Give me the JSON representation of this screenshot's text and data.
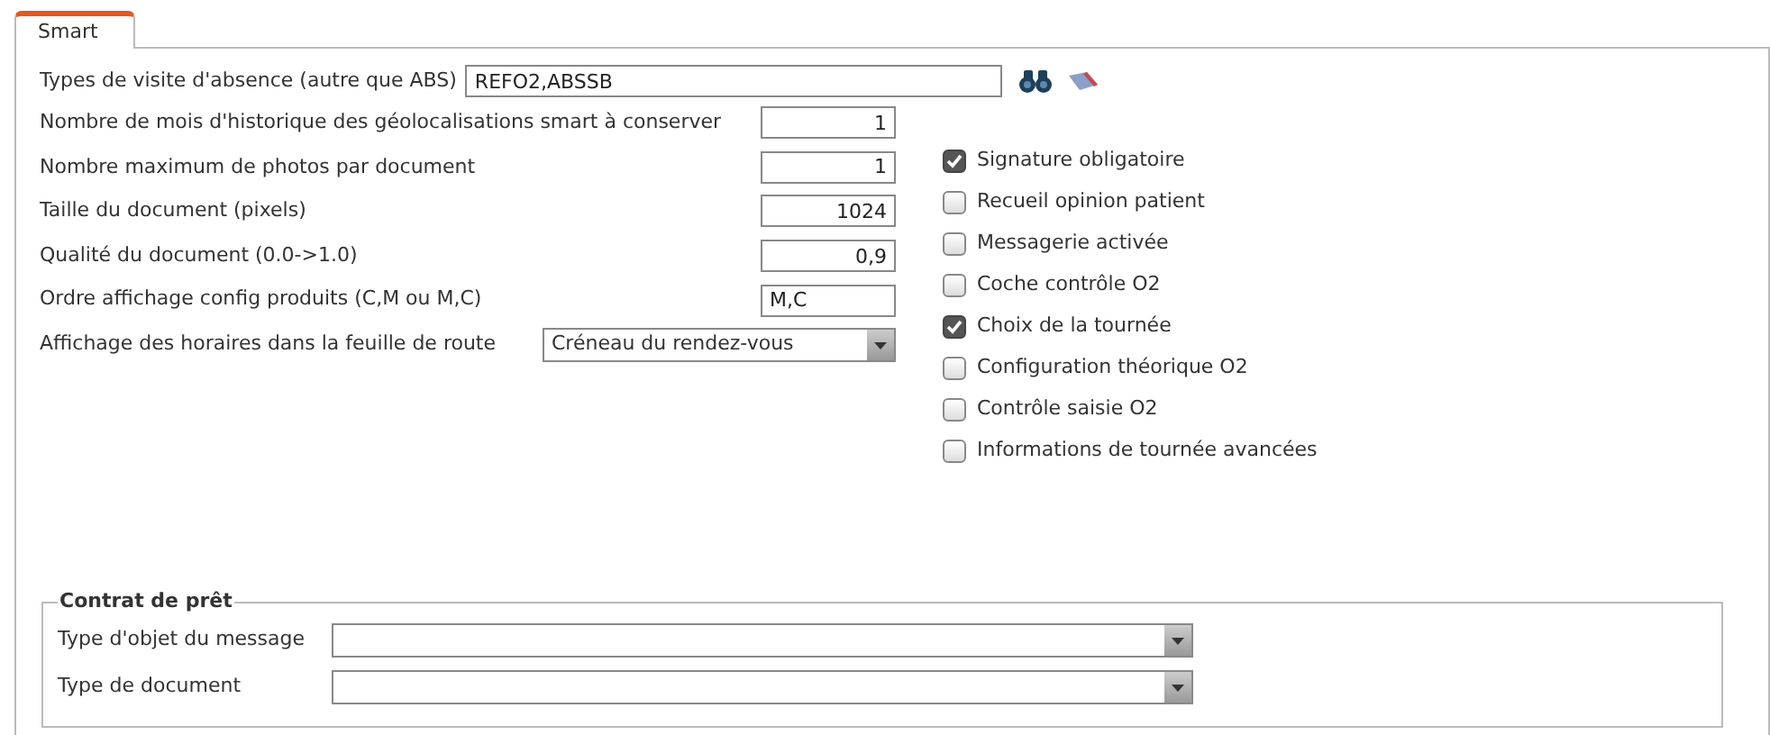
{
  "tab": {
    "label": "Smart",
    "selected": true
  },
  "absence_types": {
    "label": "Types de visite d'absence (autre que ABS)",
    "value": "REFO2,ABSSB"
  },
  "fields": [
    {
      "kind": "number",
      "label": "Nombre de mois d'historique des géolocalisations smart à conserver",
      "value": "1"
    },
    {
      "kind": "number",
      "label": "Nombre maximum de photos par document",
      "value": "1"
    },
    {
      "kind": "number",
      "label": "Taille du document (pixels)",
      "value": "1024"
    },
    {
      "kind": "number",
      "label": "Qualité du document (0.0->1.0)",
      "value": "0,9"
    },
    {
      "kind": "text",
      "label": "Ordre affichage config produits (C,M ou M,C)",
      "value": "M,C"
    },
    {
      "kind": "select",
      "label": "Affichage des horaires dans la feuille de route",
      "value": "Créneau du rendez-vous"
    }
  ],
  "options": [
    {
      "label": "Signature obligatoire",
      "checked": true
    },
    {
      "label": "Recueil opinion patient",
      "checked": false
    },
    {
      "label": "Messagerie activée",
      "checked": false
    },
    {
      "label": "Coche contrôle O2",
      "checked": false
    },
    {
      "label": "Choix de la tournée",
      "checked": true
    },
    {
      "label": "Configuration théorique O2",
      "checked": false
    },
    {
      "label": "Contrôle saisie O2",
      "checked": false
    },
    {
      "label": "Informations de tournée avancées",
      "checked": false
    }
  ],
  "loan_contract": {
    "title": "Contrat de prêt",
    "fields": [
      {
        "label": "Type d'objet du message"
      },
      {
        "label": "Type de document"
      }
    ]
  }
}
